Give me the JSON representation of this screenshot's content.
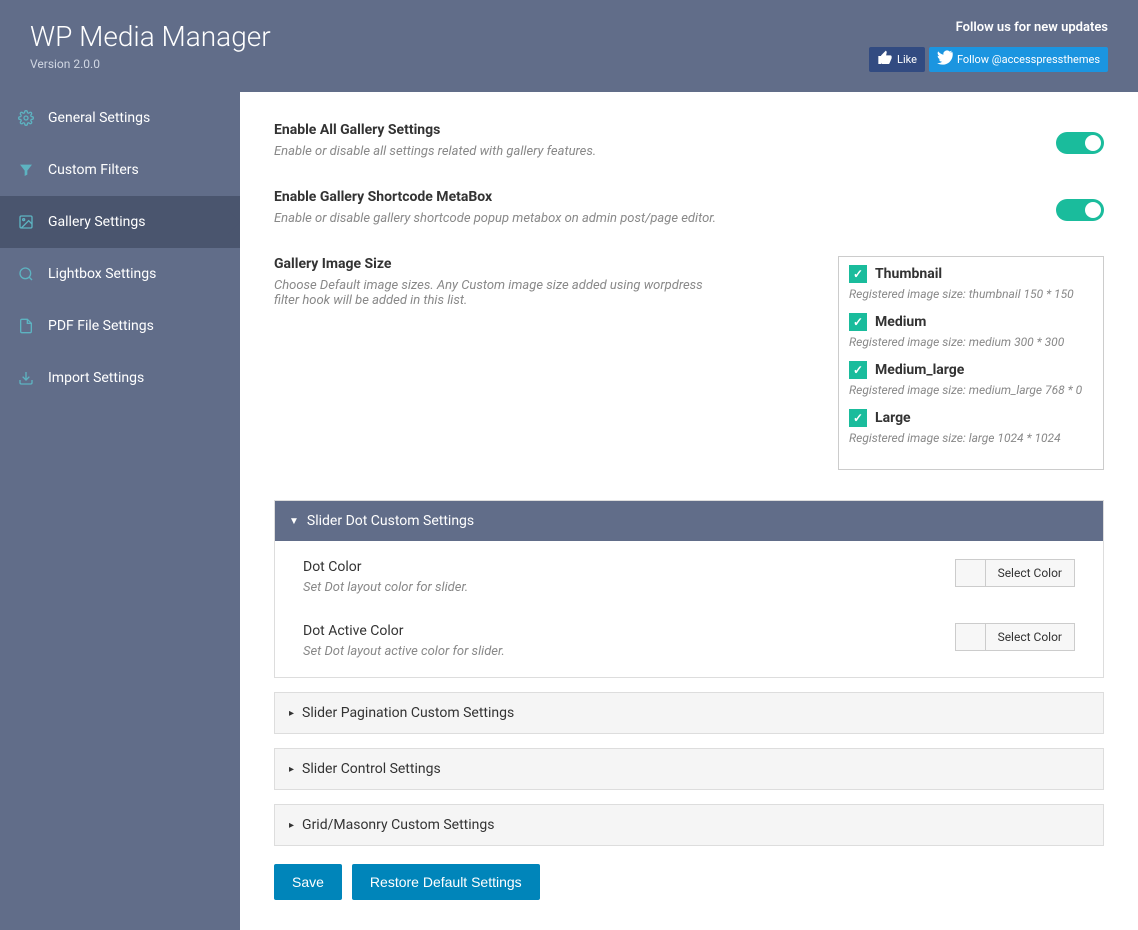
{
  "header": {
    "title": "WP Media Manager",
    "version": "Version 2.0.0",
    "follow_text": "Follow us for new updates",
    "fb_like": "Like",
    "tw_follow": "Follow @accesspressthemes"
  },
  "sidebar": {
    "items": [
      {
        "label": "General Settings"
      },
      {
        "label": "Custom Filters"
      },
      {
        "label": "Gallery Settings"
      },
      {
        "label": "Lightbox Settings"
      },
      {
        "label": "PDF File Settings"
      },
      {
        "label": "Import Settings"
      }
    ]
  },
  "settings": {
    "enable_all": {
      "title": "Enable All Gallery Settings",
      "desc": "Enable or disable all settings related with gallery features."
    },
    "enable_meta": {
      "title": "Enable Gallery Shortcode MetaBox",
      "desc": "Enable or disable gallery shortcode popup metabox on admin post/page editor."
    },
    "image_size": {
      "title": "Gallery Image Size",
      "desc": "Choose Default image sizes. Any Custom image size added using worpdress filter hook will be added in this list."
    },
    "sizes": [
      {
        "label": "Thumbnail",
        "desc": "Registered image size: thumbnail 150 * 150"
      },
      {
        "label": "Medium",
        "desc": "Registered image size: medium 300 * 300"
      },
      {
        "label": "Medium_large",
        "desc": "Registered image size: medium_large 768 * 0"
      },
      {
        "label": "Large",
        "desc": "Registered image size: large 1024 * 1024"
      }
    ]
  },
  "panels": {
    "dot": {
      "title": "Slider Dot Custom Settings",
      "rows": [
        {
          "title": "Dot Color",
          "desc": "Set Dot layout color for slider."
        },
        {
          "title": "Dot Active Color",
          "desc": "Set Dot layout active color for slider."
        }
      ]
    },
    "pag": {
      "title": "Slider Pagination Custom Settings"
    },
    "ctrl": {
      "title": "Slider Control Settings"
    },
    "grid": {
      "title": "Grid/Masonry Custom Settings"
    }
  },
  "btns": {
    "save": "Save",
    "restore": "Restore Default Settings",
    "select_color": "Select Color"
  }
}
